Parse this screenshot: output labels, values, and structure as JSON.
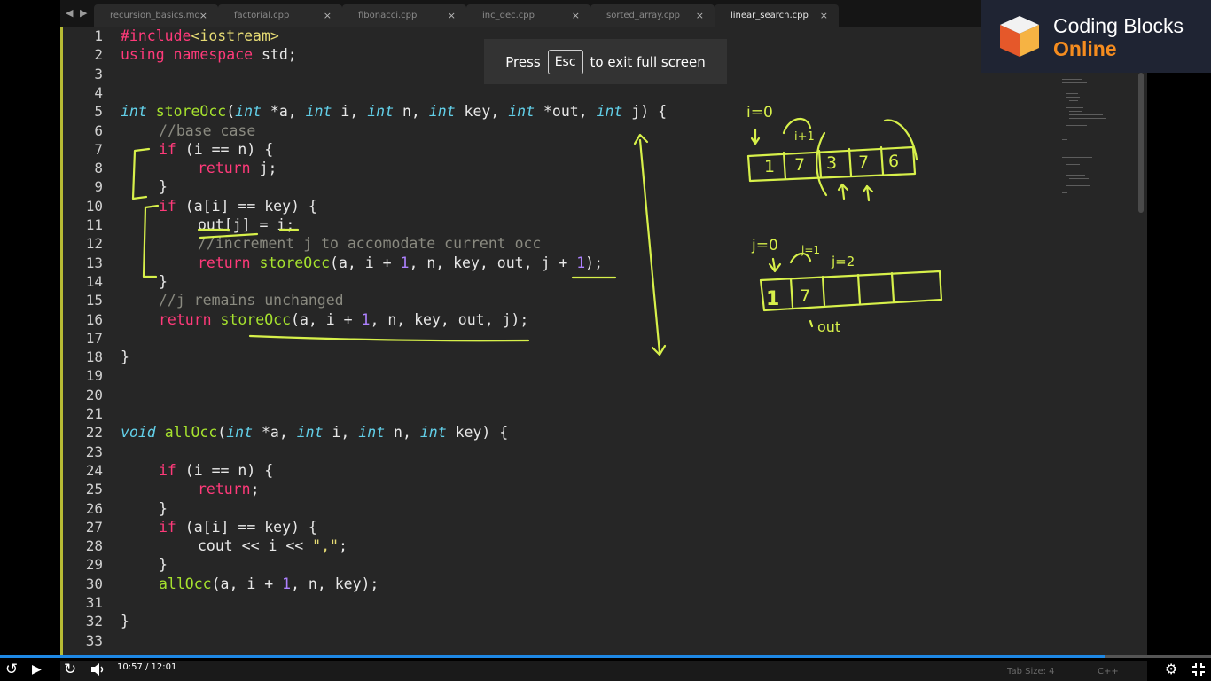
{
  "tabs": [
    {
      "label": "recursion_basics.md",
      "close": "×"
    },
    {
      "label": "factorial.cpp",
      "close": "×"
    },
    {
      "label": "fibonacci.cpp",
      "close": "×"
    },
    {
      "label": "inc_dec.cpp",
      "close": "×"
    },
    {
      "label": "sorted_array.cpp",
      "close": "×"
    },
    {
      "label": "linear_search.cpp",
      "close": "×"
    }
  ],
  "line_numbers": [
    "1",
    "2",
    "3",
    "4",
    "5",
    "6",
    "7",
    "8",
    "9",
    "10",
    "11",
    "12",
    "13",
    "14",
    "15",
    "16",
    "17",
    "18",
    "19",
    "20",
    "21",
    "22",
    "23",
    "24",
    "25",
    "26",
    "27",
    "28",
    "29",
    "30",
    "31",
    "32",
    "33"
  ],
  "code": {
    "l1_a": "#include",
    "l1_b": "<iostream>",
    "l2_a": "using",
    "l2_b": "namespace",
    "l2_c": " std;",
    "l5_type1": "int",
    "l5_fn": "storeOcc",
    "l5_p1": "(",
    "l5_t2": "int",
    "l5_p2": " *a, ",
    "l5_t3": "int",
    "l5_p3": " i, ",
    "l5_t4": "int",
    "l5_p4": " n, ",
    "l5_t5": "int",
    "l5_p5": " key, ",
    "l5_t6": "int",
    "l5_p6": " *out, ",
    "l5_t7": "int",
    "l5_p7": " j) {",
    "l6": "//base case",
    "l7_kw": "if",
    "l7_rest": " (i == n) {",
    "l8_kw": "return",
    "l8_rest": " j;",
    "l9": "}",
    "l10_kw": "if",
    "l10_rest": " (a[i] == key) {",
    "l11": "out[j] = i;",
    "l12": "//increment j to accomodate current occ",
    "l13_kw": "return",
    "l13_fn": "storeOcc",
    "l13_a": "(a, i + ",
    "l13_n1": "1",
    "l13_b": ", n, key, out, j + ",
    "l13_n2": "1",
    "l13_c": ");",
    "l14": "}",
    "l15": "//j remains unchanged",
    "l16_kw": "return",
    "l16_fn": "storeOcc",
    "l16_a": "(a, i + ",
    "l16_n1": "1",
    "l16_b": ", n, key, out, j);",
    "l18": "}",
    "l22_t1": "void",
    "l22_fn": "allOcc",
    "l22_a": "(",
    "l22_t2": "int",
    "l22_b": " *a, ",
    "l22_t3": "int",
    "l22_c": " i, ",
    "l22_t4": "int",
    "l22_d": " n, ",
    "l22_t5": "int",
    "l22_e": " key) {",
    "l24_kw": "if",
    "l24_rest": " (i == n) {",
    "l25_kw": "return",
    "l25_rest": ";",
    "l26": "}",
    "l27_kw": "if",
    "l27_rest": " (a[i] == key) {",
    "l28_a": "cout << i << ",
    "l28_str": "\",\"",
    "l28_b": ";",
    "l29": "}",
    "l30_fn": "allOcc",
    "l30_a": "(a, i + ",
    "l30_n1": "1",
    "l30_b": ", n, key);",
    "l32": "}"
  },
  "overlay": {
    "press": "Press",
    "key": "Esc",
    "rest": "to exit full screen"
  },
  "brand": {
    "line1": "Coding Blocks",
    "line2": "Online"
  },
  "annotations": {
    "top_array": [
      "1",
      "7",
      "3",
      "7",
      "6"
    ],
    "i0": "i=0",
    "ip1": "i+1",
    "bottom_array": [
      "1",
      "7"
    ],
    "j0": "j=0",
    "j1": "j=1",
    "j2": "j=2",
    "out": "out"
  },
  "status": {
    "tab_size": "Tab Size: 4",
    "syntax": "C++"
  },
  "player": {
    "time": "10:57 / 12:01",
    "progress": 0.912
  }
}
